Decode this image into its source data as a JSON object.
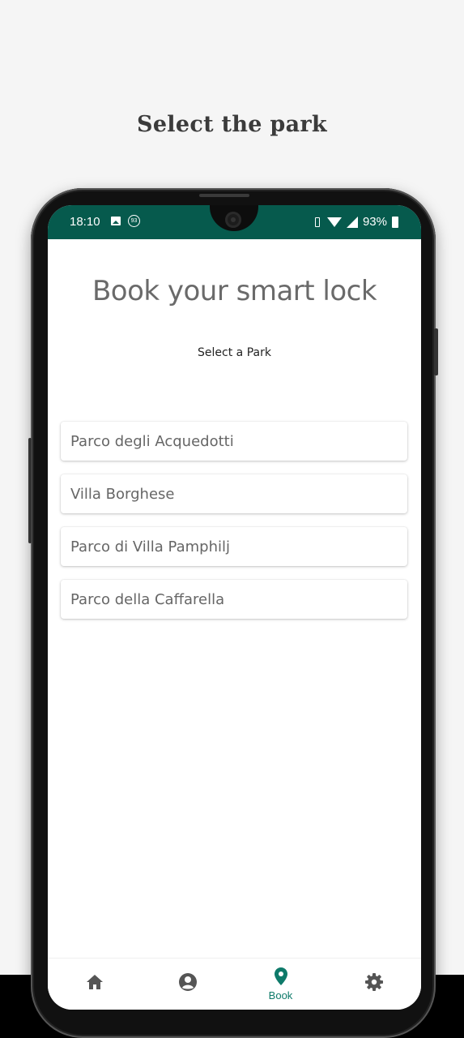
{
  "page": {
    "heading": "Select the park"
  },
  "status_bar": {
    "time": "18:10",
    "badge": "93",
    "battery": "93%"
  },
  "app": {
    "title": "Book your smart lock",
    "subtitle": "Select a Park",
    "parks": [
      "Parco degli Acquedotti",
      "Villa Borghese",
      "Parco di Villa Pamphilj",
      "Parco della Caffarella"
    ]
  },
  "nav": {
    "items": [
      {
        "icon": "home-icon",
        "label": ""
      },
      {
        "icon": "account-icon",
        "label": ""
      },
      {
        "icon": "location-pin-icon",
        "label": "Book",
        "active": true
      },
      {
        "icon": "gear-icon",
        "label": ""
      }
    ]
  },
  "colors": {
    "status_bar": "#065a4d",
    "accent": "#0e7a6a",
    "nav_icon": "#555555"
  }
}
